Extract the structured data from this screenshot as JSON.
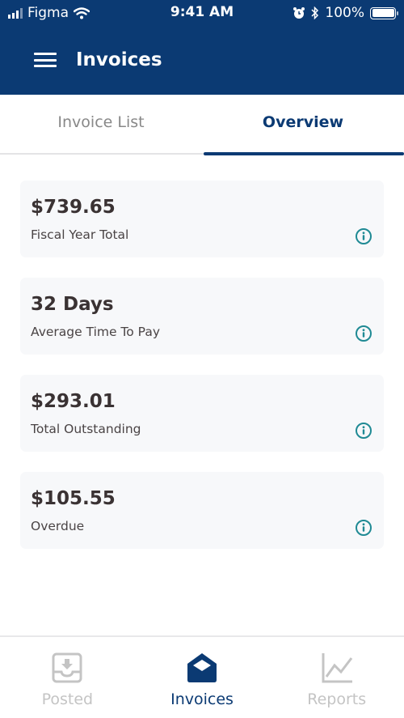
{
  "status_bar": {
    "carrier": "Figma",
    "time": "9:41 AM",
    "battery": "100%",
    "icons": [
      "signal-icon",
      "wifi-icon",
      "alarm-icon",
      "bluetooth-icon",
      "battery-icon"
    ]
  },
  "app_bar": {
    "title": "Invoices",
    "menu_icon": "hamburger-menu-icon"
  },
  "tabs": [
    {
      "label": "Invoice List",
      "active": false
    },
    {
      "label": "Overview",
      "active": true
    }
  ],
  "cards": [
    {
      "value": "$739.65",
      "label": "Fiscal Year Total",
      "icon": "info-icon"
    },
    {
      "value": "32 Days",
      "label": "Average Time To Pay",
      "icon": "info-icon"
    },
    {
      "value": "$293.01",
      "label": "Total Outstanding",
      "icon": "info-icon"
    },
    {
      "value": "$105.55",
      "label": "Overdue",
      "icon": "info-icon"
    }
  ],
  "bottom_nav": [
    {
      "label": "Posted",
      "icon": "inbox-download-icon",
      "active": false
    },
    {
      "label": "Invoices",
      "icon": "open-envelope-icon",
      "active": true
    },
    {
      "label": "Reports",
      "icon": "line-chart-icon",
      "active": false
    }
  ],
  "colors": {
    "brand": "#0b3a73",
    "info_accent": "#1f8a94",
    "inactive": "#c4c4c4",
    "card_bg": "#f7f8fa"
  }
}
